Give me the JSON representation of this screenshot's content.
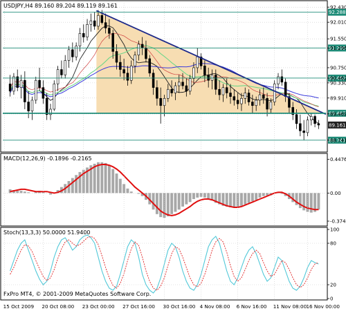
{
  "chart_data": [
    {
      "type": "candlestick",
      "header": "USDJPY,H4  89.160 89.204 89.119 89.161",
      "x_ticks": [
        "15 Oct 2009",
        "20 Oct 08:00",
        "23 Oct 00:00",
        "27 Oct 16:00",
        "30 Oct 16:00",
        "4 Nov 08:00",
        "6 Nov 16:00",
        "11 Nov 08:00",
        "16 Nov 00:00"
      ],
      "ylim": [
        88.45,
        92.55
      ],
      "y_ticks": [
        "92.430",
        "92.010",
        "91.550",
        "91.296",
        "90.750",
        "90.462",
        "90.330",
        "89.910",
        "89.469",
        "88.741"
      ],
      "price_labels": [
        {
          "value": 92.288,
          "text": "92.288",
          "color": "#1e8c78"
        },
        {
          "value": 91.296,
          "text": "91.296",
          "color": "#1e8c78"
        },
        {
          "value": 90.462,
          "text": "90.462",
          "color": "#1e8c78"
        },
        {
          "value": 89.487,
          "text": "89.487",
          "color": "#1e8c78"
        },
        {
          "value": 89.161,
          "text": "89.161",
          "color": "#222222"
        },
        {
          "value": 88.741,
          "text": "88.741",
          "color": "#1e8c78"
        }
      ],
      "candles": [
        [
          90.3,
          90.55,
          89.95,
          90.1
        ],
        [
          90.1,
          90.6,
          90.0,
          90.5
        ],
        [
          90.5,
          90.7,
          90.1,
          90.2
        ],
        [
          90.2,
          90.55,
          89.9,
          90.4
        ],
        [
          90.4,
          90.65,
          89.6,
          89.8
        ],
        [
          89.8,
          90.1,
          89.35,
          89.55
        ],
        [
          89.55,
          89.95,
          89.3,
          89.85
        ],
        [
          89.85,
          90.5,
          89.75,
          90.4
        ],
        [
          90.4,
          90.75,
          90.1,
          90.2
        ],
        [
          90.2,
          90.4,
          89.75,
          89.9
        ],
        [
          89.9,
          90.05,
          89.3,
          89.45
        ],
        [
          89.45,
          89.75,
          89.3,
          89.6
        ],
        [
          89.6,
          90.4,
          89.55,
          90.3
        ],
        [
          90.3,
          90.8,
          90.1,
          90.7
        ],
        [
          90.7,
          90.95,
          90.45,
          90.55
        ],
        [
          90.55,
          91.1,
          90.45,
          90.95
        ],
        [
          90.95,
          91.35,
          90.75,
          91.25
        ],
        [
          91.25,
          91.45,
          90.9,
          91.05
        ],
        [
          91.05,
          91.45,
          90.95,
          91.35
        ],
        [
          91.35,
          91.85,
          91.2,
          91.7
        ],
        [
          91.7,
          91.95,
          91.45,
          91.6
        ],
        [
          91.6,
          92.1,
          91.5,
          91.95
        ],
        [
          91.95,
          92.25,
          91.75,
          92.05
        ],
        [
          92.05,
          92.3,
          91.8,
          91.9
        ],
        [
          91.9,
          92.35,
          91.8,
          92.2
        ],
        [
          92.2,
          92.35,
          91.95,
          92.0
        ],
        [
          92.0,
          92.25,
          91.7,
          91.85
        ],
        [
          91.85,
          92.1,
          91.55,
          91.7
        ],
        [
          91.7,
          91.8,
          91.0,
          91.2
        ],
        [
          91.2,
          91.4,
          90.7,
          90.9
        ],
        [
          90.9,
          91.1,
          90.5,
          90.7
        ],
        [
          90.7,
          91.0,
          90.4,
          90.6
        ],
        [
          90.6,
          90.8,
          90.25,
          90.4
        ],
        [
          90.4,
          90.95,
          90.3,
          90.8
        ],
        [
          90.8,
          91.2,
          90.6,
          91.1
        ],
        [
          91.1,
          91.5,
          90.95,
          91.4
        ],
        [
          91.4,
          91.6,
          91.1,
          91.3
        ],
        [
          91.3,
          91.5,
          90.9,
          91.0
        ],
        [
          91.0,
          91.1,
          90.5,
          90.6
        ],
        [
          90.6,
          90.7,
          90.0,
          90.2
        ],
        [
          90.2,
          90.4,
          89.7,
          89.9
        ],
        [
          89.9,
          90.2,
          89.2,
          89.7
        ],
        [
          89.7,
          90.0,
          89.4,
          89.9
        ],
        [
          89.9,
          90.3,
          89.8,
          90.15
        ],
        [
          90.15,
          90.4,
          89.95,
          90.05
        ],
        [
          90.05,
          90.35,
          89.85,
          90.25
        ],
        [
          90.25,
          90.55,
          90.05,
          90.35
        ],
        [
          90.35,
          90.6,
          90.15,
          90.25
        ],
        [
          90.25,
          90.45,
          89.95,
          90.1
        ],
        [
          90.1,
          90.55,
          90.0,
          90.45
        ],
        [
          90.45,
          90.9,
          90.3,
          90.75
        ],
        [
          90.75,
          91.3,
          90.6,
          91.05
        ],
        [
          91.05,
          91.15,
          90.7,
          90.8
        ],
        [
          90.8,
          90.95,
          90.35,
          90.55
        ],
        [
          90.55,
          90.75,
          90.2,
          90.4
        ],
        [
          90.4,
          90.7,
          90.15,
          90.55
        ],
        [
          90.55,
          90.7,
          90.0,
          90.15
        ],
        [
          90.15,
          90.4,
          89.85,
          90.0
        ],
        [
          90.0,
          90.3,
          89.8,
          90.2
        ],
        [
          90.2,
          90.45,
          89.9,
          90.05
        ],
        [
          90.05,
          90.3,
          89.75,
          89.95
        ],
        [
          89.95,
          90.15,
          89.7,
          89.85
        ],
        [
          89.85,
          90.05,
          89.6,
          89.75
        ],
        [
          89.75,
          90.05,
          89.55,
          89.9
        ],
        [
          89.9,
          90.2,
          89.75,
          90.05
        ],
        [
          90.05,
          90.15,
          89.7,
          89.8
        ],
        [
          89.8,
          90.0,
          89.5,
          89.7
        ],
        [
          89.7,
          89.95,
          89.55,
          89.85
        ],
        [
          89.85,
          90.15,
          89.7,
          90.0
        ],
        [
          90.0,
          90.2,
          89.75,
          89.9
        ],
        [
          89.9,
          90.05,
          89.4,
          89.6
        ],
        [
          89.6,
          89.9,
          89.5,
          89.8
        ],
        [
          89.8,
          90.4,
          89.7,
          90.3
        ],
        [
          90.3,
          90.6,
          90.15,
          90.5
        ],
        [
          90.5,
          90.7,
          90.25,
          90.35
        ],
        [
          90.35,
          90.45,
          89.8,
          89.95
        ],
        [
          89.95,
          90.05,
          89.5,
          89.65
        ],
        [
          89.65,
          89.8,
          89.3,
          89.45
        ],
        [
          89.45,
          89.6,
          89.05,
          89.2
        ],
        [
          89.2,
          89.45,
          88.85,
          89.0
        ],
        [
          89.0,
          89.3,
          88.74,
          88.95
        ],
        [
          88.95,
          89.4,
          88.85,
          89.3
        ],
        [
          89.3,
          89.49,
          89.15,
          89.4
        ],
        [
          89.4,
          89.45,
          89.1,
          89.2
        ],
        [
          89.2,
          89.3,
          89.05,
          89.16
        ]
      ],
      "x_range": [
        -2,
        86
      ]
    },
    {
      "type": "bar",
      "title": "MACD(12,26,9) -0.1896 -0.2165",
      "y_ticks": [
        "0.4476",
        "0.00",
        "-0.374"
      ],
      "ylim": [
        -0.42,
        0.5
      ],
      "ytick_values": [
        0.4476,
        0.0,
        -0.374
      ],
      "histogram": [
        0.05,
        0.04,
        0.03,
        0.03,
        0.02,
        0.01,
        0.0,
        0.02,
        0.03,
        0.02,
        0.0,
        -0.02,
        0.0,
        0.04,
        0.08,
        0.12,
        0.16,
        0.2,
        0.24,
        0.28,
        0.31,
        0.34,
        0.37,
        0.39,
        0.41,
        0.41,
        0.4,
        0.37,
        0.32,
        0.26,
        0.19,
        0.12,
        0.06,
        0.02,
        0.0,
        -0.01,
        -0.04,
        -0.09,
        -0.15,
        -0.22,
        -0.28,
        -0.32,
        -0.33,
        -0.31,
        -0.28,
        -0.25,
        -0.22,
        -0.18,
        -0.15,
        -0.12,
        -0.08,
        -0.06,
        -0.05,
        -0.06,
        -0.08,
        -0.1,
        -0.13,
        -0.15,
        -0.17,
        -0.18,
        -0.19,
        -0.19,
        -0.18,
        -0.17,
        -0.15,
        -0.13,
        -0.11,
        -0.09,
        -0.06,
        -0.04,
        -0.03,
        -0.03,
        0.0,
        0.01,
        -0.01,
        -0.04,
        -0.08,
        -0.12,
        -0.16,
        -0.2,
        -0.23,
        -0.25,
        -0.26,
        -0.25,
        -0.22
      ],
      "signal": [
        0.02,
        0.03,
        0.04,
        0.05,
        0.05,
        0.04,
        0.03,
        0.02,
        0.02,
        0.02,
        0.02,
        0.01,
        0.0,
        0.01,
        0.03,
        0.06,
        0.1,
        0.14,
        0.18,
        0.22,
        0.26,
        0.29,
        0.32,
        0.35,
        0.37,
        0.38,
        0.38,
        0.37,
        0.35,
        0.32,
        0.28,
        0.23,
        0.18,
        0.13,
        0.08,
        0.04,
        0.0,
        -0.04,
        -0.09,
        -0.14,
        -0.19,
        -0.24,
        -0.27,
        -0.29,
        -0.3,
        -0.29,
        -0.27,
        -0.24,
        -0.21,
        -0.18,
        -0.14,
        -0.11,
        -0.09,
        -0.08,
        -0.08,
        -0.09,
        -0.11,
        -0.13,
        -0.15,
        -0.17,
        -0.18,
        -0.19,
        -0.19,
        -0.18,
        -0.16,
        -0.14,
        -0.12,
        -0.1,
        -0.08,
        -0.06,
        -0.04,
        -0.02,
        0.0,
        0.01,
        0.01,
        -0.01,
        -0.04,
        -0.08,
        -0.12,
        -0.15,
        -0.18,
        -0.2,
        -0.21,
        -0.22,
        -0.22
      ]
    },
    {
      "type": "line",
      "title": "Stoch(13,3,3) 50.0000 51.9400",
      "ylim": [
        0,
        100
      ],
      "y_ticks": [
        "100",
        "80",
        "20",
        "0"
      ],
      "ytick_values": [
        100,
        80,
        20,
        0
      ],
      "main": [
        40,
        55,
        70,
        80,
        85,
        70,
        55,
        40,
        28,
        20,
        25,
        40,
        60,
        75,
        85,
        88,
        80,
        70,
        75,
        85,
        90,
        92,
        88,
        80,
        60,
        40,
        25,
        15,
        12,
        18,
        35,
        55,
        75,
        85,
        80,
        60,
        35,
        20,
        12,
        8,
        15,
        30,
        50,
        70,
        80,
        75,
        60,
        40,
        25,
        15,
        12,
        20,
        35,
        55,
        75,
        85,
        90,
        80,
        60,
        40,
        25,
        20,
        30,
        45,
        60,
        70,
        75,
        65,
        50,
        35,
        25,
        30,
        45,
        60,
        55,
        40,
        25,
        15,
        12,
        18,
        30,
        45,
        55,
        52,
        50
      ],
      "signal": [
        35,
        45,
        58,
        70,
        78,
        76,
        68,
        55,
        43,
        32,
        26,
        30,
        42,
        58,
        72,
        82,
        85,
        80,
        76,
        78,
        83,
        88,
        90,
        87,
        78,
        62,
        45,
        30,
        19,
        15,
        22,
        36,
        55,
        72,
        82,
        77,
        60,
        40,
        25,
        15,
        12,
        18,
        30,
        48,
        65,
        75,
        72,
        60,
        45,
        30,
        20,
        17,
        22,
        35,
        52,
        70,
        82,
        87,
        82,
        67,
        48,
        32,
        25,
        30,
        42,
        55,
        65,
        70,
        65,
        52,
        40,
        32,
        35,
        45,
        55,
        52,
        42,
        30,
        20,
        16,
        20,
        30,
        42,
        50,
        52
      ]
    }
  ],
  "footer": {
    "brand": "FxPro MT4, © 2001-2009 MetaQuotes Software Corp."
  },
  "colors": {
    "triangle_fill": "#f7ddb2",
    "trendline": "#1e2a8a",
    "support_line": "#1e8c78",
    "ma_black": "#222222",
    "ma_blue": "#3b3bdc",
    "ma_green": "#6fd78a",
    "ma_red": "#d04040",
    "macd_hist": "#a8a8a8",
    "macd_signal": "#e01010",
    "stoch_main": "#50c8d8",
    "stoch_signal": "#e02020"
  }
}
